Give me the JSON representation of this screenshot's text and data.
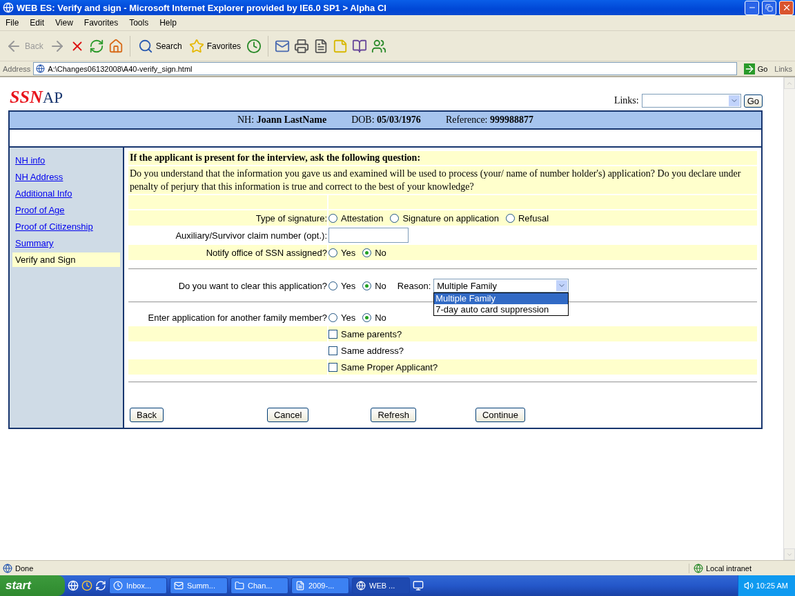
{
  "window": {
    "title": "WEB ES: Verify and sign - Microsoft Internet Explorer provided by IE6.0 SP1  > Alpha CI"
  },
  "menu": [
    "File",
    "Edit",
    "View",
    "Favorites",
    "Tools",
    "Help"
  ],
  "toolbar": {
    "back": {
      "label": "Back",
      "disabled": true
    },
    "search": "Search",
    "favorites": "Favorites"
  },
  "address_bar": {
    "label": "Address",
    "value": "A:\\Changes06132008\\A40-verify_sign.html",
    "go": "Go",
    "links": "Links"
  },
  "page": {
    "logo": {
      "first": "SSN",
      "second": "AP"
    },
    "links_label": "Links:",
    "links_go": "Go",
    "header": [
      {
        "label": "NH:",
        "value": "Joann LastName"
      },
      {
        "label": "DOB:",
        "value": "05/03/1976"
      },
      {
        "label": "Reference:",
        "value": "999988877"
      }
    ],
    "sidebar": [
      {
        "label": "NH info",
        "selected": false
      },
      {
        "label": "NH Address",
        "selected": false
      },
      {
        "label": "Additional Info",
        "selected": false
      },
      {
        "label": "Proof of Age",
        "selected": false
      },
      {
        "label": "Proof of Citizenship",
        "selected": false
      },
      {
        "label": "Summary",
        "selected": false
      },
      {
        "label": "Verify and Sign",
        "selected": true
      }
    ],
    "question_heading": "If the applicant is present for the interview, ask the following question:",
    "question": "Do you understand that the information you gave us and examined will be used to process (your/ name of number holder's) application? Do you declare under penalty of perjury that this information is true and correct to the best of your knowledge?",
    "signature": {
      "label": "Type of signature:",
      "options": [
        {
          "label": "Attestation",
          "selected": false
        },
        {
          "label": "Signature on application",
          "selected": false
        },
        {
          "label": "Refusal",
          "selected": false
        }
      ]
    },
    "claim_number": {
      "label": "Auxiliary/Survivor claim number (opt.):"
    },
    "notify": {
      "label": "Notify office of SSN assigned?",
      "options": [
        {
          "label": "Yes",
          "selected": false
        },
        {
          "label": "No",
          "selected": true
        }
      ]
    },
    "clear": {
      "label": "Do you want to clear this application?",
      "options": [
        {
          "label": "Yes",
          "selected": false
        },
        {
          "label": "No",
          "selected": true
        }
      ],
      "reason_label": "Reason:",
      "reason_value": "Multiple Family",
      "reason_expanded": true,
      "reason_options": [
        {
          "label": "Multiple Family",
          "selected": true
        },
        {
          "label": "7-day auto card suppression",
          "selected": false
        }
      ]
    },
    "family": {
      "label": "Enter application for another family member?",
      "options": [
        {
          "label": "Yes",
          "selected": false
        },
        {
          "label": "No",
          "selected": true
        }
      ]
    },
    "family_checks": [
      {
        "label": "Same parents?",
        "checked": false
      },
      {
        "label": "Same address?",
        "checked": false
      },
      {
        "label": "Same Proper Applicant?",
        "checked": false
      }
    ],
    "buttons": [
      "Back",
      "Cancel",
      "Refresh",
      "Continue"
    ]
  },
  "status_bar": {
    "text": "Done",
    "zone": "Local intranet"
  },
  "taskbar": {
    "start": "start",
    "tasks": [
      {
        "label": "Inbox...",
        "selected": false
      },
      {
        "label": "Summ...",
        "selected": false
      },
      {
        "label": "Chan...",
        "selected": false
      },
      {
        "label": "2009-...",
        "selected": false
      },
      {
        "label": "WEB ...",
        "selected": true
      }
    ],
    "clock": "10:25 AM"
  }
}
